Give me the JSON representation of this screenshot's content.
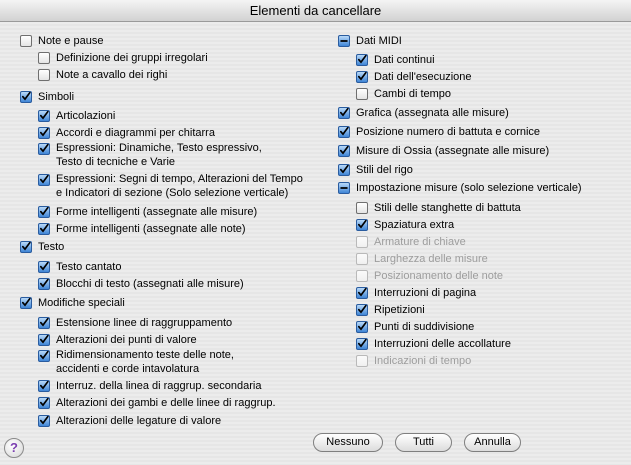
{
  "window": {
    "title": "Elementi da cancellare"
  },
  "left_column": {
    "note_pause": {
      "label": "Note e pause",
      "state": "unchecked"
    },
    "gruppi_irregolari": {
      "label": "Definizione dei gruppi irregolari",
      "state": "unchecked"
    },
    "note_cavallo": {
      "label": "Note a cavallo dei righi",
      "state": "unchecked"
    },
    "simboli": {
      "label": "Simboli",
      "state": "checked"
    },
    "articolazioni": {
      "label": "Articolazioni",
      "state": "checked"
    },
    "accordi": {
      "label": "Accordi e diagrammi per chitarra",
      "state": "checked"
    },
    "espressioni_dinamiche": {
      "label_line1": "Espressioni: Dinamiche, Testo espressivo,",
      "label_line2": "Testo di tecniche e Varie",
      "state": "checked"
    },
    "espressioni_segni": {
      "label_line1": "Espressioni: Segni di tempo, Alterazioni del Tempo",
      "label_line2": "e Indicatori di sezione (Solo selezione verticale)",
      "state": "checked"
    },
    "forme_misure": {
      "label": "Forme intelligenti (assegnate alle misure)",
      "state": "checked"
    },
    "forme_note": {
      "label": "Forme intelligenti (assegnate alle note)",
      "state": "checked"
    },
    "testo": {
      "label": "Testo",
      "state": "checked"
    },
    "testo_cantato": {
      "label": "Testo cantato",
      "state": "checked"
    },
    "blocchi_testo": {
      "label": "Blocchi di testo (assegnati alle misure)",
      "state": "checked"
    },
    "modifiche": {
      "label": "Modifiche speciali",
      "state": "checked"
    },
    "estensione_linee": {
      "label": "Estensione linee di raggruppamento",
      "state": "checked"
    },
    "alterazioni_punti": {
      "label": "Alterazioni dei punti di valore",
      "state": "checked"
    },
    "ridimensionamento": {
      "label_line1": "Ridimensionamento teste delle note,",
      "label_line2": "accidenti e corde intavolatura",
      "state": "checked"
    },
    "interruz_linea": {
      "label": "Interruz. della linea di raggrup. secondaria",
      "state": "checked"
    },
    "alterazioni_gambi": {
      "label": "Alterazioni dei gambi e delle linee di raggrup.",
      "state": "checked"
    },
    "alterazioni_legature": {
      "label": "Alterazioni delle legature di valore",
      "state": "checked"
    }
  },
  "right_column": {
    "dati_midi": {
      "label": "Dati MIDI",
      "state": "mixed"
    },
    "dati_continui": {
      "label": "Dati continui",
      "state": "checked"
    },
    "dati_esecuzione": {
      "label": "Dati dell'esecuzione",
      "state": "checked"
    },
    "cambi_tempo": {
      "label": "Cambi di tempo",
      "state": "unchecked"
    },
    "grafica": {
      "label": "Grafica (assegnata alle misure)",
      "state": "checked"
    },
    "posizione_numero": {
      "label": "Posizione numero di battuta e cornice",
      "state": "checked"
    },
    "misure_ossia": {
      "label": "Misure di Ossia (assegnate alle misure)",
      "state": "checked"
    },
    "stili_rigo": {
      "label": "Stili del rigo",
      "state": "checked"
    },
    "impostazione_misure": {
      "label": "Impostazione misure (solo selezione verticale)",
      "state": "mixed"
    },
    "stili_stanghette": {
      "label": "Stili delle stanghette di battuta",
      "state": "unchecked"
    },
    "spaziatura": {
      "label": "Spaziatura extra",
      "state": "checked"
    },
    "armature": {
      "label": "Armature di chiave",
      "state": "disabled"
    },
    "larghezza": {
      "label": "Larghezza delle misure",
      "state": "disabled"
    },
    "posizionamento": {
      "label": "Posizionamento delle note",
      "state": "disabled"
    },
    "interruzioni_pagina": {
      "label": "Interruzioni di pagina",
      "state": "checked"
    },
    "ripetizioni": {
      "label": "Ripetizioni",
      "state": "checked"
    },
    "punti_suddivisione": {
      "label": "Punti di suddivisione",
      "state": "checked"
    },
    "interruzioni_accollature": {
      "label": "Interruzioni delle accollature",
      "state": "checked"
    },
    "indicazioni_tempo": {
      "label": "Indicazioni di tempo",
      "state": "disabled"
    }
  },
  "buttons": {
    "none": "Nessuno",
    "all": "Tutti",
    "cancel": "Annulla",
    "help": "?"
  },
  "colors": {
    "accent": "#3f85d6",
    "disabled_text": "#9d9d9d",
    "help": "#7b3fb0"
  }
}
